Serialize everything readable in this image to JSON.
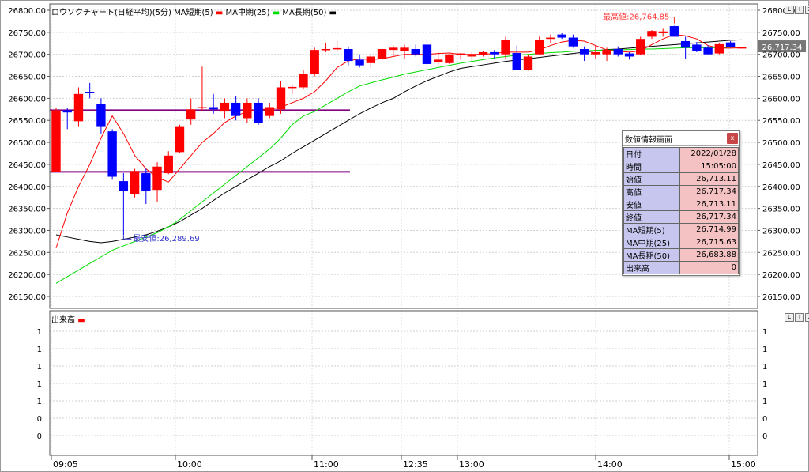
{
  "price_panel": {
    "title": "ロウソクチャート(日経平均)(5分)",
    "ma_labels": [
      "MA短期(5)",
      "MA中期(25)",
      "MA長期(50)"
    ],
    "high_label": "最高値:26,764.85",
    "low_label": "最安値:26,289.69",
    "current_price": "26,717.34",
    "y_ticks": [
      "26800.00",
      "26750.00",
      "26700.00",
      "26650.00",
      "26600.00",
      "26550.00",
      "26500.00",
      "26450.00",
      "26400.00",
      "26350.00",
      "26300.00",
      "26250.00",
      "26200.00",
      "26150.00"
    ],
    "controls": [
      "L",
      "I",
      "X"
    ]
  },
  "volume_panel": {
    "title": "出来高",
    "y_ticks": [
      "1",
      "1",
      "1",
      "1",
      "1",
      "0",
      "0"
    ],
    "controls": [
      "L",
      "I",
      "X"
    ]
  },
  "time_labels": [
    "09:05",
    "10:00",
    "11:00",
    "12:35",
    "13:00",
    "14:00",
    "15:00"
  ],
  "info_panel": {
    "title": "数値情報画面",
    "close_label": "x",
    "rows": [
      {
        "k": "日付",
        "v": "2022/01/28"
      },
      {
        "k": "時間",
        "v": "15:05:00"
      },
      {
        "k": "始値",
        "v": "26,713.11"
      },
      {
        "k": "高値",
        "v": "26,717.34"
      },
      {
        "k": "安値",
        "v": "26,713.11"
      },
      {
        "k": "終値",
        "v": "26,717.34"
      },
      {
        "k": "MA短期(5)",
        "v": "26,714.99"
      },
      {
        "k": "MA中期(25)",
        "v": "26,715.63"
      },
      {
        "k": "MA長期(50)",
        "v": "26,683.88"
      },
      {
        "k": "出来高",
        "v": "0"
      }
    ]
  },
  "colors": {
    "up": "#ff0000",
    "down": "#0000ff",
    "ma_short": "#ff0000",
    "ma_mid": "#00dd00",
    "ma_long": "#000000",
    "hline": "#800080",
    "high_label": "#ff3333",
    "low_label": "#3333cc"
  },
  "chart_data": {
    "type": "candlestick",
    "y_axis_range": [
      26150,
      26800
    ],
    "candles": [
      {
        "o": 26433,
        "h": 26578,
        "l": 26433,
        "c": 26573
      },
      {
        "o": 26573,
        "h": 26578,
        "l": 26530,
        "c": 26568
      },
      {
        "o": 26548,
        "h": 26625,
        "l": 26535,
        "c": 26610
      },
      {
        "o": 26615,
        "h": 26635,
        "l": 26600,
        "c": 26612
      },
      {
        "o": 26588,
        "h": 26600,
        "l": 26520,
        "c": 26535
      },
      {
        "o": 26525,
        "h": 26530,
        "l": 26415,
        "c": 26422
      },
      {
        "o": 26412,
        "h": 26430,
        "l": 26289.69,
        "c": 26390
      },
      {
        "o": 26382,
        "h": 26440,
        "l": 26375,
        "c": 26435
      },
      {
        "o": 26430,
        "h": 26440,
        "l": 26360,
        "c": 26390
      },
      {
        "o": 26392,
        "h": 26455,
        "l": 26365,
        "c": 26445
      },
      {
        "o": 26430,
        "h": 26480,
        "l": 26428,
        "c": 26470
      },
      {
        "o": 26478,
        "h": 26540,
        "l": 26475,
        "c": 26535
      },
      {
        "o": 26552,
        "h": 26600,
        "l": 26540,
        "c": 26575
      },
      {
        "o": 26578,
        "h": 26672,
        "l": 26572,
        "c": 26580
      },
      {
        "o": 26580,
        "h": 26610,
        "l": 26565,
        "c": 26575
      },
      {
        "o": 26570,
        "h": 26600,
        "l": 26555,
        "c": 26590
      },
      {
        "o": 26590,
        "h": 26605,
        "l": 26550,
        "c": 26560
      },
      {
        "o": 26555,
        "h": 26600,
        "l": 26545,
        "c": 26590
      },
      {
        "o": 26590,
        "h": 26600,
        "l": 26540,
        "c": 26545
      },
      {
        "o": 26560,
        "h": 26590,
        "l": 26555,
        "c": 26580
      },
      {
        "o": 26575,
        "h": 26640,
        "l": 26565,
        "c": 26625
      },
      {
        "o": 26626,
        "h": 26632,
        "l": 26610,
        "c": 26626
      },
      {
        "o": 26625,
        "h": 26665,
        "l": 26620,
        "c": 26655
      },
      {
        "o": 26655,
        "h": 26715,
        "l": 26650,
        "c": 26710
      },
      {
        "o": 26710,
        "h": 26725,
        "l": 26705,
        "c": 26712
      },
      {
        "o": 26714,
        "h": 26730,
        "l": 26705,
        "c": 26714
      },
      {
        "o": 26712,
        "h": 26718,
        "l": 26675,
        "c": 26685
      },
      {
        "o": 26688,
        "h": 26700,
        "l": 26670,
        "c": 26675
      },
      {
        "o": 26680,
        "h": 26700,
        "l": 26670,
        "c": 26695
      },
      {
        "o": 26690,
        "h": 26715,
        "l": 26685,
        "c": 26712
      },
      {
        "o": 26710,
        "h": 26720,
        "l": 26695,
        "c": 26715
      },
      {
        "o": 26708,
        "h": 26722,
        "l": 26690,
        "c": 26715
      },
      {
        "o": 26712,
        "h": 26722,
        "l": 26695,
        "c": 26700
      },
      {
        "o": 26722,
        "h": 26735,
        "l": 26675,
        "c": 26678
      },
      {
        "o": 26682,
        "h": 26705,
        "l": 26675,
        "c": 26688
      },
      {
        "o": 26680,
        "h": 26700,
        "l": 26678,
        "c": 26700
      },
      {
        "o": 26698,
        "h": 26703,
        "l": 26688,
        "c": 26702
      },
      {
        "o": 26695,
        "h": 26705,
        "l": 26685,
        "c": 26700
      },
      {
        "o": 26700,
        "h": 26708,
        "l": 26695,
        "c": 26705
      },
      {
        "o": 26705,
        "h": 26710,
        "l": 26690,
        "c": 26700
      },
      {
        "o": 26700,
        "h": 26740,
        "l": 26690,
        "c": 26732
      },
      {
        "o": 26703,
        "h": 26720,
        "l": 26665,
        "c": 26665
      },
      {
        "o": 26665,
        "h": 26700,
        "l": 26663,
        "c": 26695
      },
      {
        "o": 26700,
        "h": 26740,
        "l": 26698,
        "c": 26733
      },
      {
        "o": 26735,
        "h": 26745,
        "l": 26725,
        "c": 26738
      },
      {
        "o": 26745,
        "h": 26748,
        "l": 26735,
        "c": 26738
      },
      {
        "o": 26738,
        "h": 26745,
        "l": 26715,
        "c": 26718
      },
      {
        "o": 26712,
        "h": 26718,
        "l": 26685,
        "c": 26700
      },
      {
        "o": 26700,
        "h": 26720,
        "l": 26690,
        "c": 26705
      },
      {
        "o": 26700,
        "h": 26715,
        "l": 26685,
        "c": 26710
      },
      {
        "o": 26712,
        "h": 26718,
        "l": 26695,
        "c": 26700
      },
      {
        "o": 26702,
        "h": 26705,
        "l": 26688,
        "c": 26695
      },
      {
        "o": 26700,
        "h": 26740,
        "l": 26698,
        "c": 26735
      },
      {
        "o": 26740,
        "h": 26755,
        "l": 26735,
        "c": 26753
      },
      {
        "o": 26748,
        "h": 26758,
        "l": 26740,
        "c": 26752
      },
      {
        "o": 26764,
        "h": 26764.85,
        "l": 26740,
        "c": 26740
      },
      {
        "o": 26730,
        "h": 26740,
        "l": 26690,
        "c": 26715
      },
      {
        "o": 26722,
        "h": 26728,
        "l": 26705,
        "c": 26708
      },
      {
        "o": 26715,
        "h": 26720,
        "l": 26700,
        "c": 26700
      },
      {
        "o": 26702,
        "h": 26725,
        "l": 26700,
        "c": 26723
      },
      {
        "o": 26727,
        "h": 26730,
        "l": 26715,
        "c": 26717
      },
      {
        "o": 26713.11,
        "h": 26717.34,
        "l": 26713.11,
        "c": 26717.34
      }
    ],
    "ma_short": [
      26260,
      26340,
      26400,
      26450,
      26510,
      26560,
      26520,
      26470,
      26440,
      26420,
      26410,
      26440,
      26470,
      26500,
      26520,
      26545,
      26560,
      26570,
      26575,
      26575,
      26580,
      26590,
      26600,
      26615,
      26640,
      26670,
      26685,
      26690,
      26688,
      26690,
      26695,
      26700,
      26700,
      26700,
      26702,
      26703,
      26700,
      26700,
      26700,
      26702,
      26705,
      26705,
      26705,
      26710,
      26720,
      26728,
      26732,
      26730,
      26720,
      26710,
      26707,
      26705,
      26708,
      26722,
      26735,
      26745,
      26742,
      26735,
      26720,
      26714,
      26714,
      26715
    ],
    "ma_mid": [
      26180,
      26195,
      26210,
      26225,
      26240,
      26255,
      26265,
      26275,
      26285,
      26295,
      26308,
      26325,
      26345,
      26365,
      26385,
      26405,
      26425,
      26445,
      26465,
      26485,
      26510,
      26540,
      26560,
      26570,
      26585,
      26600,
      26615,
      26628,
      26635,
      26642,
      26648,
      26655,
      26660,
      26665,
      26670,
      26675,
      26680,
      26684,
      26688,
      26692,
      26695,
      26698,
      26700,
      26702,
      26704,
      26705,
      26707,
      26708,
      26709,
      26710,
      26710,
      26711,
      26712,
      26712,
      26713,
      26714,
      26715,
      26715,
      26715,
      26715,
      26716,
      26716
    ],
    "ma_long": [
      26290,
      26285,
      26280,
      26275,
      26272,
      26275,
      26280,
      26285,
      26290,
      26298,
      26308,
      26320,
      26335,
      26350,
      26368,
      26385,
      26400,
      26415,
      26430,
      26445,
      26458,
      26475,
      26490,
      26505,
      26520,
      26535,
      26550,
      26565,
      26578,
      26590,
      26600,
      26615,
      26628,
      26640,
      26650,
      26660,
      26668,
      26672,
      26676,
      26680,
      26684,
      26687,
      26690,
      26693,
      26696,
      26699,
      26702,
      26705,
      26708,
      26711,
      26712,
      26714,
      26716,
      26718,
      26720,
      26722,
      26724,
      26726,
      26728,
      26730,
      26732,
      26733
    ]
  }
}
